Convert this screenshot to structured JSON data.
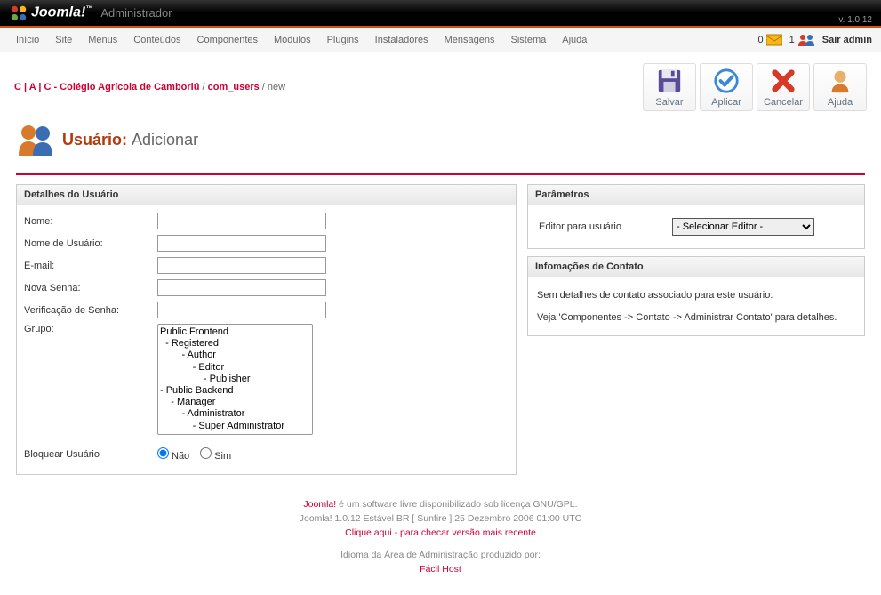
{
  "header": {
    "brand": "Joomla!",
    "subtitle": "Administrador",
    "version": "v. 1.0.12"
  },
  "menubar": {
    "items": [
      "Início",
      "Site",
      "Menus",
      "Conteúdos",
      "Componentes",
      "Módulos",
      "Plugins",
      "Instaladores",
      "Mensagens",
      "Sistema",
      "Ajuda"
    ],
    "msg_count": "0",
    "user_count": "1",
    "logout": "Sair admin"
  },
  "breadcrumb": {
    "site": "C | A | C - Colégio Agrícola de Camboriú",
    "component": "com_users",
    "current": "new"
  },
  "toolbar": {
    "save": "Salvar",
    "apply": "Aplicar",
    "cancel": "Cancelar",
    "help": "Ajuda"
  },
  "page": {
    "title": "Usuário:",
    "action": "Adicionar"
  },
  "details": {
    "legend": "Detalhes do Usuário",
    "name_label": "Nome:",
    "username_label": "Nome de Usuário:",
    "email_label": "E-mail:",
    "newpass_label": "Nova Senha:",
    "verifypass_label": "Verificação de Senha:",
    "group_label": "Grupo:",
    "group_options": [
      "Public Frontend",
      ". - Registered",
      ".   .   - Author",
      ".   .   .   - Editor",
      ".   .   .   .   - Publisher",
      "- Public Backend",
      ".   - Manager",
      ".   .   - Administrator",
      ".   .   .   - Super Administrator"
    ],
    "block_label": "Bloquear Usuário",
    "no": "Não",
    "yes": "Sim"
  },
  "params": {
    "legend": "Parâmetros",
    "editor_label": "Editor para usuário",
    "editor_selected": "- Selecionar Editor -"
  },
  "contact": {
    "legend": "Infomações de Contato",
    "line1": "Sem detalhes de contato associado para este usuário:",
    "line2": "Veja 'Componentes -> Contato -> Administrar Contato' para detalhes."
  },
  "footer": {
    "l1a": "Joomla!",
    "l1b": " é um software livre disponibilizado sob licença GNU/GPL.",
    "l2": "Joomla! 1.0.12 Estável BR [ Sunfire ] 25 Dezembro 2006 01:00 UTC",
    "l3": "Clique aqui - para checar versão mais recente",
    "l4": "Idioma da Área de Administração produzido por:",
    "l5": "Fácil Host"
  }
}
